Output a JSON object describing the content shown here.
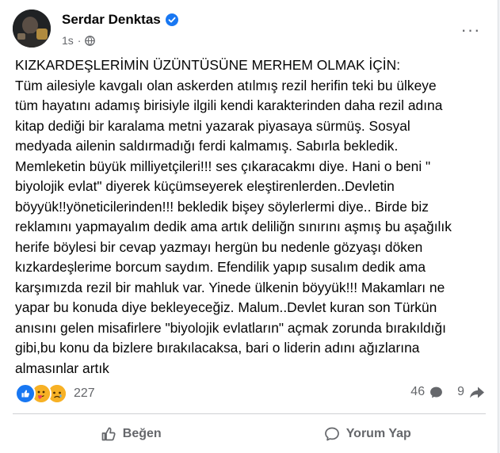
{
  "author": {
    "name": "Serdar Denktas",
    "verified": true,
    "time": "1s",
    "separator": "·",
    "audience_icon": "globe-icon"
  },
  "menu": {
    "more_label": "···"
  },
  "post": {
    "title_line": "KIZKARDEŞLERİMİN ÜZÜNTÜSÜNE MERHEM OLMAK İÇİN:",
    "lines": [
      "Tüm ailesiyle kavgalı olan askerden atılmış rezil herifin teki bu ülkeye",
      "tüm hayatını adamış birisiyle ilgili kendi karakterinden daha rezil adına",
      "kitap dediği bir karalama metni yazarak piyasaya sürmüş. Sosyal",
      "medyada ailenin saldırmadığı ferdi kalmamış. Sabırla bekledik.",
      "Memleketin büyük milliyetçileri!!! ses çıkaracakmı diye. Hani o beni \"",
      "biyolojik evlat\" diyerek küçümseyerek eleştirenlerden..Devletin",
      "böyyük!!yöneticilerinden!!! bekledik bişey söylerlermi diye.. Birde biz",
      "reklamını yapmayalım dedik ama artık deliliğn sınırını aşmış bu aşağılık",
      "herife böylesi bir cevap yazmayı hergün bu nedenle gözyaşı döken",
      "kızkardeşlerime borcum saydım. Efendilik yapıp susalım dedik ama",
      "karşımızda rezil bir mahluk var. Yinede ülkenin böyyük!!! Makamları ne",
      "yapar bu konuda diye bekleyeceğiz. Malum..Devlet kuran son Türkün",
      "anısını gelen misafirlere \"biyolojik evlatların\" açmak zorunda bırakıldığı",
      "gibi,bu konu da bizlere bırakılacaksa, bari o liderin adını ağızlarına",
      "almasınlar artık"
    ]
  },
  "reactions": {
    "icons": [
      "like-reaction-icon",
      "care-reaction-icon",
      "sad-reaction-icon"
    ],
    "count": "227"
  },
  "stats": {
    "comments": "46",
    "shares": "9"
  },
  "actions": {
    "like_label": "Beğen",
    "comment_label": "Yorum Yap"
  },
  "colors": {
    "accent": "#1877f2",
    "secondary_text": "#65676b",
    "primary_text": "#050505",
    "reaction_yellow": "#f7b125",
    "divider": "#ced0d4"
  }
}
